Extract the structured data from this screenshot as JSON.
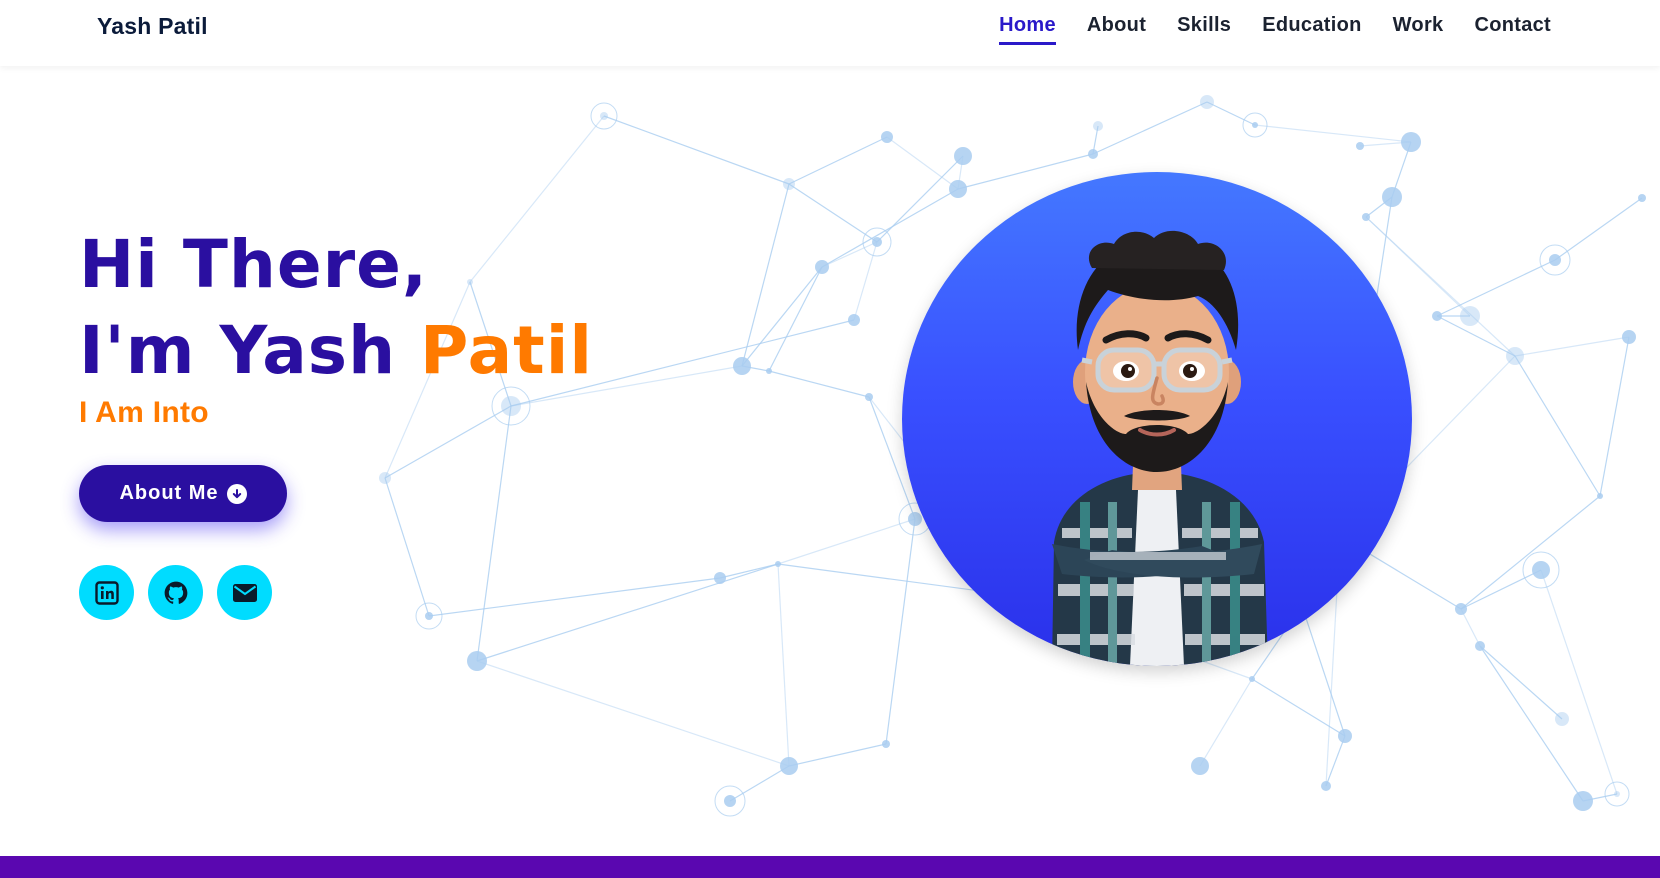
{
  "header": {
    "brand": "Yash Patil",
    "nav": [
      {
        "label": "Home",
        "active": true
      },
      {
        "label": "About",
        "active": false
      },
      {
        "label": "Skills",
        "active": false
      },
      {
        "label": "Education",
        "active": false
      },
      {
        "label": "Work",
        "active": false
      },
      {
        "label": "Contact",
        "active": false
      }
    ]
  },
  "hero": {
    "greeting": "Hi There,",
    "intro_prefix": "I'm Yash ",
    "intro_accent": "Patil",
    "subtitle": "I Am Into",
    "button_label": "About Me",
    "button_icon": "arrow-down-circle-icon",
    "socials": [
      {
        "name": "linkedin-icon"
      },
      {
        "name": "github-icon"
      },
      {
        "name": "email-icon"
      }
    ]
  },
  "colors": {
    "primary": "#2a0fa0",
    "accent": "#ff7a00",
    "nav_active": "#2a19c9",
    "social_bg": "#00dcff",
    "network": "#a9cdf0",
    "bottom_bar": "#5a07b0"
  }
}
